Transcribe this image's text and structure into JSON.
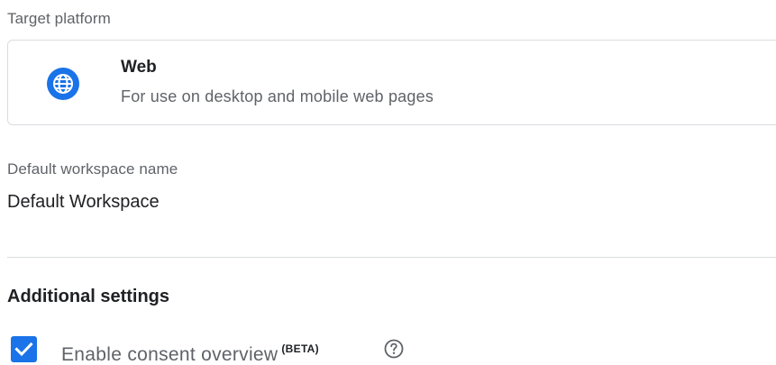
{
  "target_platform": {
    "label": "Target platform",
    "selected": {
      "icon": "globe-icon",
      "name": "Web",
      "description": "For use on desktop and mobile web pages"
    }
  },
  "workspace": {
    "label": "Default workspace name",
    "value": "Default Workspace"
  },
  "additional_settings": {
    "heading": "Additional settings",
    "consent_overview": {
      "label": "Enable consent overview",
      "badge": "(BETA)",
      "checked": true,
      "help_icon": "help-circle-icon"
    }
  },
  "colors": {
    "accent": "#1a73e8",
    "text_primary": "#202124",
    "text_secondary": "#5f6368",
    "border": "#dadce0"
  }
}
